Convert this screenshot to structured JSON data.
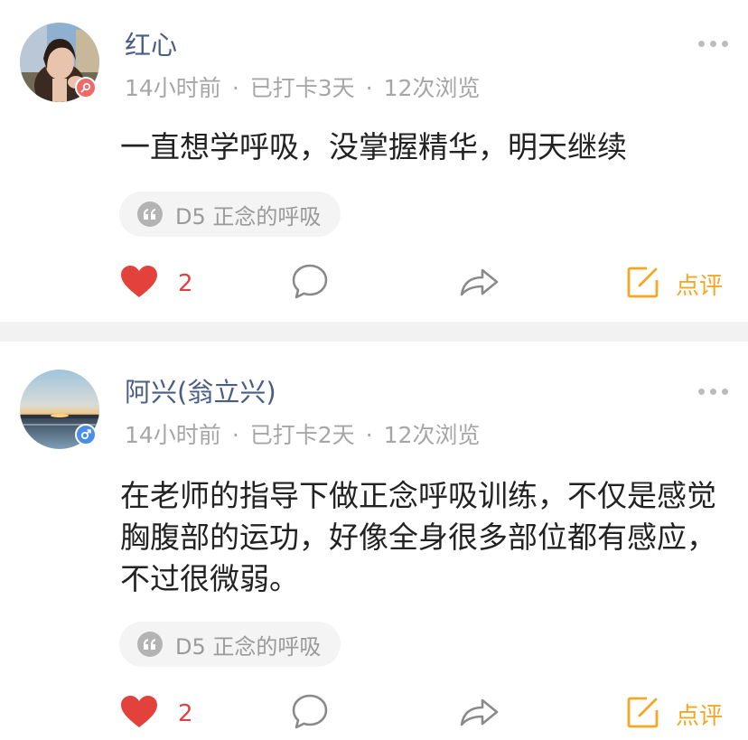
{
  "posts": [
    {
      "username": "红心",
      "time": "14小时前",
      "checkin": "已打卡3天",
      "views": "12次浏览",
      "content": "一直想学呼吸，没掌握精华，明天继续",
      "tag": "D5 正念的呼吸",
      "likes": "2",
      "review_label": "点评",
      "gender": "female",
      "gender_color": "#f06a6a"
    },
    {
      "username": "阿兴(翁立兴)",
      "time": "14小时前",
      "checkin": "已打卡2天",
      "views": "12次浏览",
      "content": "在老师的指导下做正念呼吸训练，不仅是感觉胸腹部的运功，好像全身很多部位都有感应，不过很微弱。",
      "tag": "D5 正念的呼吸",
      "likes": "2",
      "review_label": "点评",
      "gender": "male",
      "gender_color": "#4a8fe7"
    }
  ],
  "separator": "·",
  "colors": {
    "username": "#4a5d86",
    "like": "#e2413c",
    "review": "#f5a623",
    "meta": "#a6a6a6"
  },
  "icons": [
    "heart-icon",
    "comment-icon",
    "share-icon",
    "review-icon",
    "quote-icon",
    "more-icon"
  ]
}
